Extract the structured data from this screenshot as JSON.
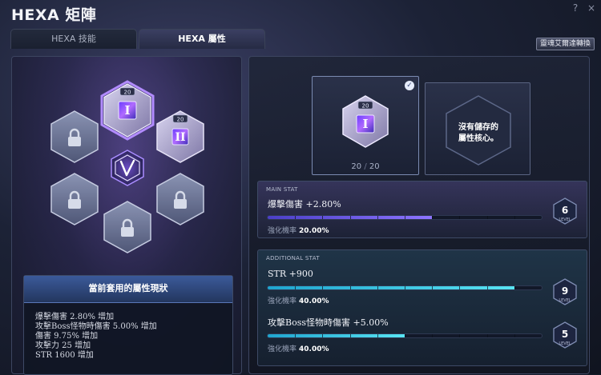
{
  "window": {
    "title": "HEXA 矩陣"
  },
  "win_icons": [
    "?",
    "×"
  ],
  "tabs": [
    {
      "label": "HEXA 技能",
      "active": false
    },
    {
      "label": "HEXA 屬性",
      "active": true
    }
  ],
  "convert_button": "靈魂艾爾達轉換",
  "hex_grid": {
    "center_icon": "hexa-v-emblem-icon",
    "cores": [
      {
        "slot": "top",
        "level": "20",
        "icon": "hexa-stat-core-1-icon",
        "numeral": "I",
        "selected": true
      },
      {
        "slot": "upper-right",
        "level": "20",
        "icon": "hexa-stat-core-2-icon",
        "numeral": "II",
        "selected": false
      },
      {
        "slot": "upper-left",
        "locked": true,
        "icon": "lock-icon"
      },
      {
        "slot": "lower-left",
        "locked": true,
        "icon": "lock-icon"
      },
      {
        "slot": "lower-right",
        "locked": true,
        "icon": "lock-icon"
      },
      {
        "slot": "bottom",
        "locked": true,
        "icon": "lock-icon"
      }
    ]
  },
  "status": {
    "title": "當前套用的屬性現狀",
    "lines": [
      "爆擊傷害 2.80% 增加",
      "攻擊Boss怪物時傷害 5.00% 增加",
      "傷害 9.75% 增加",
      "攻擊力 25 增加",
      "STR 1600 增加"
    ]
  },
  "selected_core": {
    "level_badge": "20",
    "numeral": "I",
    "level_current": "20",
    "level_sep": "/",
    "level_max": "20",
    "check_icon": "checkmark-icon"
  },
  "empty_slot": {
    "line1": "沒有儲存的",
    "line2": "屬性核心。"
  },
  "main_stat": {
    "label": "MAIN STAT",
    "name": "爆擊傷害 +2.80%",
    "chance_label": "強化機率",
    "chance_value": "20.00%",
    "progress": 0.6,
    "level": "6",
    "level_word": "LEVEL"
  },
  "additional_stat": {
    "label": "ADDITIONAL STAT",
    "stats": [
      {
        "name": "STR +900",
        "chance_label": "強化機率",
        "chance_value": "40.00%",
        "progress": 0.9,
        "level": "9",
        "level_word": "LEVEL"
      },
      {
        "name": "攻擊Boss怪物時傷害 +5.00%",
        "chance_label": "強化機率",
        "chance_value": "40.00%",
        "progress": 0.5,
        "level": "5",
        "level_word": "LEVEL"
      }
    ]
  },
  "colors": {
    "accent_purple": "#8d74ff",
    "accent_cyan": "#58e4f3",
    "selected_border": "#b28cff"
  }
}
